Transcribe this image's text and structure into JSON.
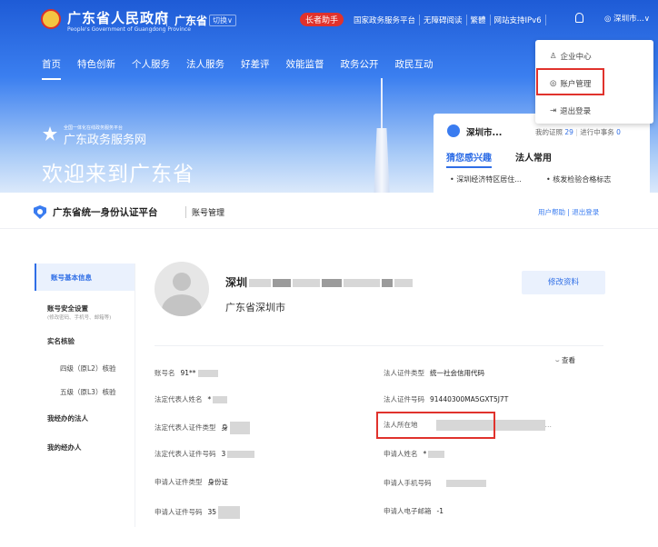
{
  "portal": {
    "site_title": "广东省人民政府",
    "site_subtitle": "People's Government of Guangdong Province",
    "region": "广东省",
    "switch_label": "切换∨",
    "elder_mode": "长者助手",
    "top_links": [
      "国家政务服务平台",
      "无障碍阅读",
      "繁體",
      "网站支持IPv6"
    ],
    "user_menu_label": "◎ 深圳市...∨",
    "nav": [
      "首页",
      "特色创新",
      "个人服务",
      "法人服务",
      "好差评",
      "效能监督",
      "政务公开",
      "政民互动"
    ],
    "dropdown": [
      {
        "icon": "building-icon",
        "glyph": "♙",
        "label": "企业中心"
      },
      {
        "icon": "account-icon",
        "glyph": "◎",
        "label": "账户管理"
      },
      {
        "icon": "logout-icon",
        "glyph": "⇥",
        "label": "退出登录"
      }
    ],
    "gov_service_small": "全国一体化在线政务服务平台",
    "gov_service_name": "广东政务服务网",
    "welcome": "欢迎来到广东省",
    "card": {
      "name": "深圳市...",
      "certs_label": "我的证照",
      "certs_count": "29",
      "pending_label": "进行中事务",
      "pending_count": "0",
      "tab_interest": "猜您感兴趣",
      "tab_common": "法人常用",
      "item1": "• 深圳经济特区居住...",
      "item2": "• 核发检验合格标志"
    }
  },
  "account": {
    "title": "广东省统一身份认证平台",
    "subtitle": "账号管理",
    "links": "用户帮助 | 退出登录",
    "sidebar": {
      "basic_info": "账号基本信息",
      "security": "账号安全设置",
      "security_hint": "(修改密码、手机号、邮箱等)",
      "realname": "实名核验",
      "level4": "四级（原L2）核验",
      "level5": "五级（原L3）核验",
      "managed_legal": "我经办的法人",
      "managers": "我的经办人"
    },
    "profile": {
      "name_prefix": "深圳",
      "region": "广东省深圳市",
      "edit_label": "修改资料",
      "view_label": "查看"
    },
    "fields_left": [
      {
        "label": "账号名",
        "value": "91**"
      },
      {
        "label": "法定代表人姓名",
        "value": "*"
      },
      {
        "label": "法定代表人证件类型",
        "value": "身"
      },
      {
        "label": "法定代表人证件号码",
        "value": "3"
      },
      {
        "label": "申请人证件类型",
        "value": "身份证"
      },
      {
        "label": "申请人证件号码",
        "value": "35"
      }
    ],
    "fields_right": [
      {
        "label": "法人证件类型",
        "value": "统一社会信用代码"
      },
      {
        "label": "法人证件号码",
        "value": "91440300MA5GXT5J7T"
      },
      {
        "label": "法人所在地",
        "value": ""
      },
      {
        "label": "申请人姓名",
        "value": "*"
      },
      {
        "label": "申请人手机号码",
        "value": ""
      },
      {
        "label": "申请人电子邮箱",
        "value": "-1"
      }
    ],
    "accent_color": "#2f6ee6",
    "highlight_color": "#e0322c"
  }
}
